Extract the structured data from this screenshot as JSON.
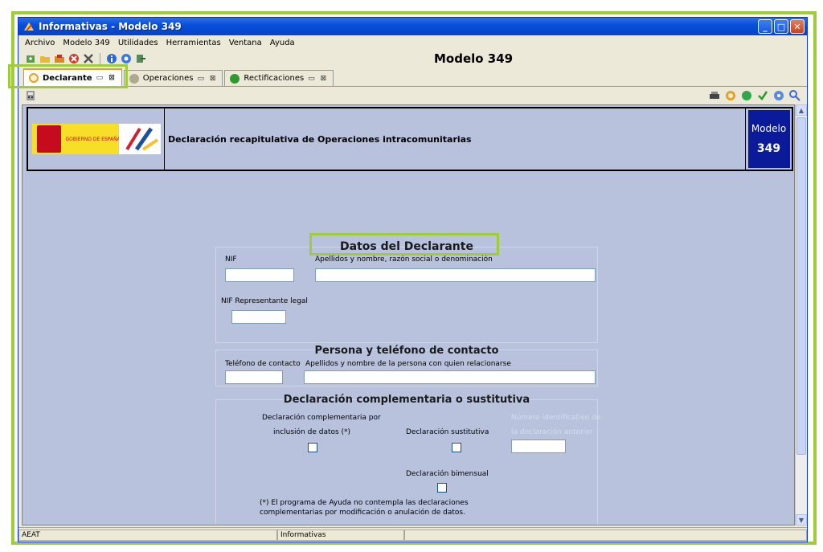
{
  "window": {
    "title": "Informativas - Modelo 349",
    "minimize": "_",
    "maximize": "□",
    "close": "✕"
  },
  "menu": [
    "Archivo",
    "Modelo 349",
    "Utilidades",
    "Herramientas",
    "Ventana",
    "Ayuda"
  ],
  "toolbar": {
    "modelo_title": "Modelo 349"
  },
  "tabs": [
    {
      "label": "Declarante",
      "ctrl": "▭ ⊠",
      "color": "#e6a02f"
    },
    {
      "label": "Operaciones",
      "ctrl": "▭ ⊠",
      "color": "#a8a8a8"
    },
    {
      "label": "Rectificaciones",
      "ctrl": "▭ ⊠",
      "color": "#2e9a2e"
    }
  ],
  "header": {
    "gov_text": "GOBIERNO DE ESPAÑA",
    "title": "Declaración recapitulativa de Operaciones intracomunitarias",
    "badge_line1": "Modelo",
    "badge_line2": "349"
  },
  "datos_declarante": {
    "title": "Datos del Declarante",
    "nif_label": "NIF",
    "nombre_label": "Apellidos y nombre,  razón social o denominación",
    "nif_rep_label": "NIF Representante legal"
  },
  "contacto": {
    "title": "Persona y teléfono de contacto",
    "telefono_label": "Teléfono de contacto",
    "persona_label": "Apellidos y nombre de la persona con quien relacionarse"
  },
  "complementaria": {
    "title": "Declaración complementaria o sustitutiva",
    "comp_label_1": "Declaración complementaria por",
    "comp_label_2": "inclusión de datos (*)",
    "sust_label": "Declaración sustitutiva",
    "num_label_1": "Número identificativo de",
    "num_label_2": "la declaración anterior",
    "bimensual_label": "Declaración bimensual",
    "note_1": "(*) El programa de Ayuda no contempla las declaraciones",
    "note_2": "complementarias por modificación o anulación de datos."
  },
  "status": {
    "left": "AEAT",
    "middle": "Informativas"
  },
  "colors": {
    "highlight": "#9fcd3a",
    "content_bg": "#b8c2dd",
    "badge_bg": "#0a1a99"
  },
  "icons": [
    "new-icon",
    "open-icon",
    "save-icon",
    "delete-icon",
    "tools-icon",
    "info-icon",
    "help-icon",
    "exit-icon",
    "print-icon",
    "calc-icon",
    "validate-icon",
    "check-icon",
    "help-circle-icon",
    "search-help-icon"
  ]
}
